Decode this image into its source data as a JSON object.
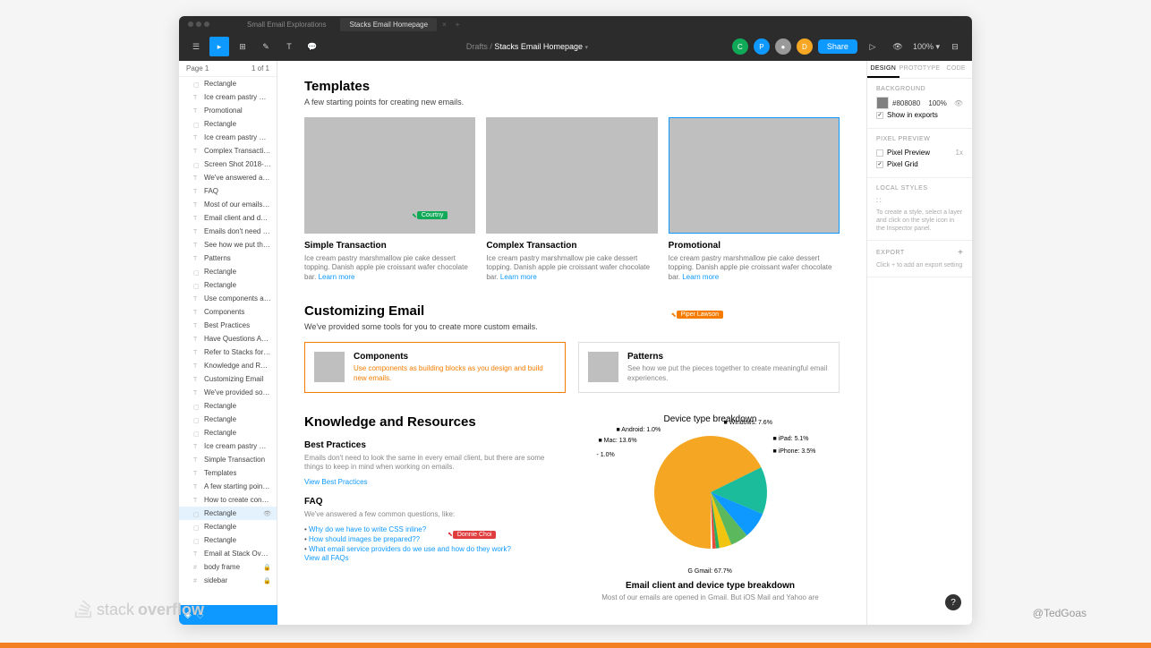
{
  "tabs": {
    "inactive": "Small Email Explorations",
    "active": "Stacks Email Homepage"
  },
  "breadcrumb": {
    "drafts": "Drafts",
    "title": "Stacks Email Homepage"
  },
  "toolbar": {
    "share": "Share",
    "zoom": "100%"
  },
  "layers": {
    "header": "Page 1",
    "count": "1 of 1",
    "items": [
      "Rectangle",
      "Ice cream pastry marshmallo...",
      "Promotional",
      "Rectangle",
      "Ice cream pastry marshmallo...",
      "Complex Transaction",
      "Screen Shot 2018-07-05 at 1...",
      "We've answered a few comm...",
      "FAQ",
      "Most of our emails are opene...",
      "Email client and device type ...",
      "Emails don't need to look the...",
      "See how we put the pieces to...",
      "Patterns",
      "Rectangle",
      "Rectangle",
      "Use components as building ...",
      "Components",
      "Best Practices",
      "Have Questions About Email?",
      "Refer to Stacks for guideline...",
      "Knowledge and Resources",
      "Customizing Email",
      "We've provided some tools f...",
      "Rectangle",
      "Rectangle",
      "Rectangle",
      "Ice cream pastry marshmallo...",
      "Simple Transaction",
      "Templates",
      "A few starting points for crea...",
      "How to create consistently-d...",
      "Rectangle",
      "Rectangle",
      "Rectangle",
      "Email at Stack Overflow",
      "body frame",
      "sidebar"
    ],
    "selected_index": 32
  },
  "canvas": {
    "templates": {
      "title": "Templates",
      "sub": "A few starting points for creating new emails.",
      "cards": [
        {
          "title": "Simple Transaction",
          "desc": "Ice cream pastry marshmallow pie cake dessert topping. Danish apple pie croissant wafer chocolate bar.",
          "link": "Learn more"
        },
        {
          "title": "Complex Transaction",
          "desc": "Ice cream pastry marshmallow pie cake dessert topping. Danish apple pie croissant wafer chocolate bar.",
          "link": "Learn more"
        },
        {
          "title": "Promotional",
          "desc": "Ice cream pastry marshmallow pie cake dessert topping. Danish apple pie croissant wafer chocolate bar.",
          "link": "Learn more"
        }
      ]
    },
    "custom": {
      "title": "Customizing Email",
      "sub": "We've provided some tools for you to create more custom emails.",
      "cards": [
        {
          "title": "Components",
          "desc": "Use components as building blocks as you design and build new emails."
        },
        {
          "title": "Patterns",
          "desc": "See how we put the pieces together to create meaningful email experiences."
        }
      ]
    },
    "knowledge": {
      "title": "Knowledge and Resources",
      "bp_title": "Best Practices",
      "bp_text": "Emails don't need to look the same in every email client, but there are some things to keep in mind when working on emails.",
      "bp_link": "View Best Practices",
      "faq_title": "FAQ",
      "faq_text": "We've answered a few common questions, like:",
      "faq_items": [
        "Why do we have to write CSS inline?",
        "How should images be prepared??",
        "What email service providers do we use and how do they work?"
      ],
      "faq_link": "View all FAQs",
      "chart_caption": "Email client and device type breakdown",
      "chart_sub": "Most of our emails are opened in Gmail. But iOS Mail and Yahoo are"
    },
    "cursors": {
      "courtney": "Courtny",
      "piper": "Piper Lawson",
      "donnie": "Donnie Choi"
    }
  },
  "chart_data": {
    "type": "pie",
    "title": "Device type breakdown",
    "series": [
      {
        "name": "G Gmail",
        "value": 67.7,
        "color": "#f5a623"
      },
      {
        "name": "Mac",
        "value": 13.6,
        "color": "#1abc9c"
      },
      {
        "name": "Windows",
        "value": 7.6,
        "color": "#0d99ff"
      },
      {
        "name": "iPad",
        "value": 5.1,
        "color": "#5cb85c"
      },
      {
        "name": "iPhone",
        "value": 3.5,
        "color": "#f1c40f"
      },
      {
        "name": "Android",
        "value": 1.0,
        "color": "#27ae60"
      },
      {
        "name": "-",
        "value": 1.0,
        "color": "#e74c3c"
      }
    ]
  },
  "inspector": {
    "tabs": [
      "DESIGN",
      "PROTOTYPE",
      "CODE"
    ],
    "bg": {
      "label": "BACKGROUND",
      "hex": "#808080",
      "pct": "100%",
      "show": "Show in exports"
    },
    "pixel": {
      "label": "PIXEL PREVIEW",
      "preview": "Pixel Preview",
      "mult": "1x",
      "grid": "Pixel Grid"
    },
    "styles": {
      "label": "LOCAL STYLES",
      "help": "To create a style, select a layer and click on the style icon in the Inspector panel."
    },
    "export": {
      "label": "EXPORT",
      "help": "Click + to add an export setting"
    }
  },
  "footer": {
    "brand1": "stack",
    "brand2": "overflow",
    "handle": "@TedGoas"
  }
}
